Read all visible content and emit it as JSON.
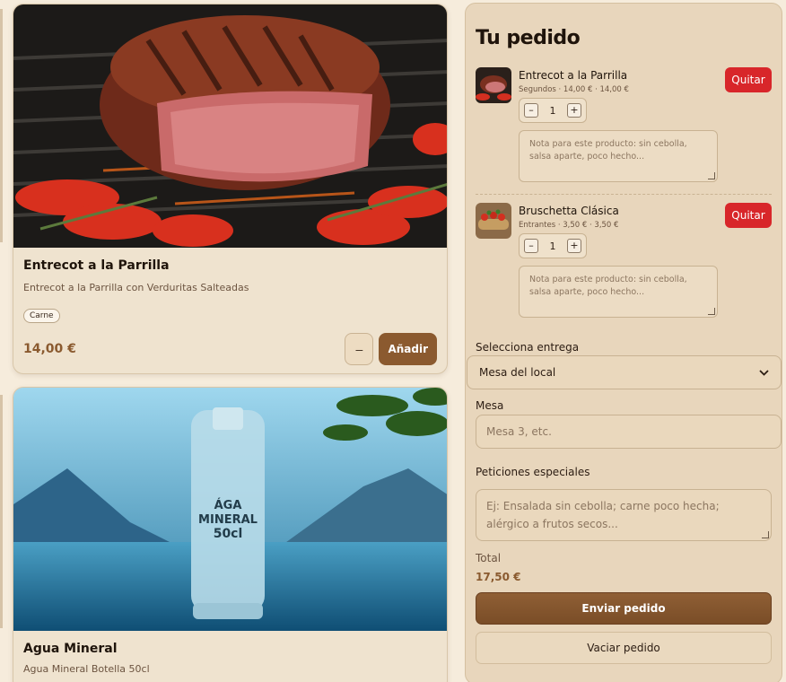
{
  "products": [
    {
      "name": "Entrecot a la Parrilla",
      "description": "Entrecot a la Parrilla con Verduritas Salteadas",
      "tag": "Carne",
      "price": "14,00 €",
      "minus_label": "–",
      "add_label": "Añadir"
    },
    {
      "name": "Agua Mineral",
      "description": "Agua Mineral Botella 50cl",
      "bottle_label_line1": "ÁGA",
      "bottle_label_line2": "MINERAL",
      "bottle_label_line3": "50cl"
    }
  ],
  "order": {
    "title": "Tu pedido",
    "remove_label": "Quitar",
    "note_placeholder": "Nota para este producto: sin cebolla, salsa aparte, poco hecho...",
    "items": [
      {
        "name": "Entrecot a la Parrilla",
        "meta": "Segundos · 14,00 € · 14,00 €",
        "qty": "1",
        "minus": "–",
        "plus": "+"
      },
      {
        "name": "Bruschetta Clásica",
        "meta": "Entrantes · 3,50 € · 3,50 €",
        "qty": "1",
        "minus": "–",
        "plus": "+"
      }
    ],
    "delivery_label": "Selecciona entrega",
    "delivery_value": "Mesa del local",
    "table_label": "Mesa",
    "table_placeholder": "Mesa 3, etc.",
    "requests_label": "Peticiones especiales",
    "requests_placeholder": "Ej: Ensalada sin cebolla; carne poco hecha; alérgico a frutos secos...",
    "total_label": "Total",
    "total_value": "17,50 €",
    "send_label": "Enviar pedido",
    "clear_label": "Vaciar pedido"
  },
  "colors": {
    "accent": "#8b5a2f",
    "danger": "#d8262a",
    "panel": "#e8d6bc",
    "card": "#efe3cf"
  }
}
